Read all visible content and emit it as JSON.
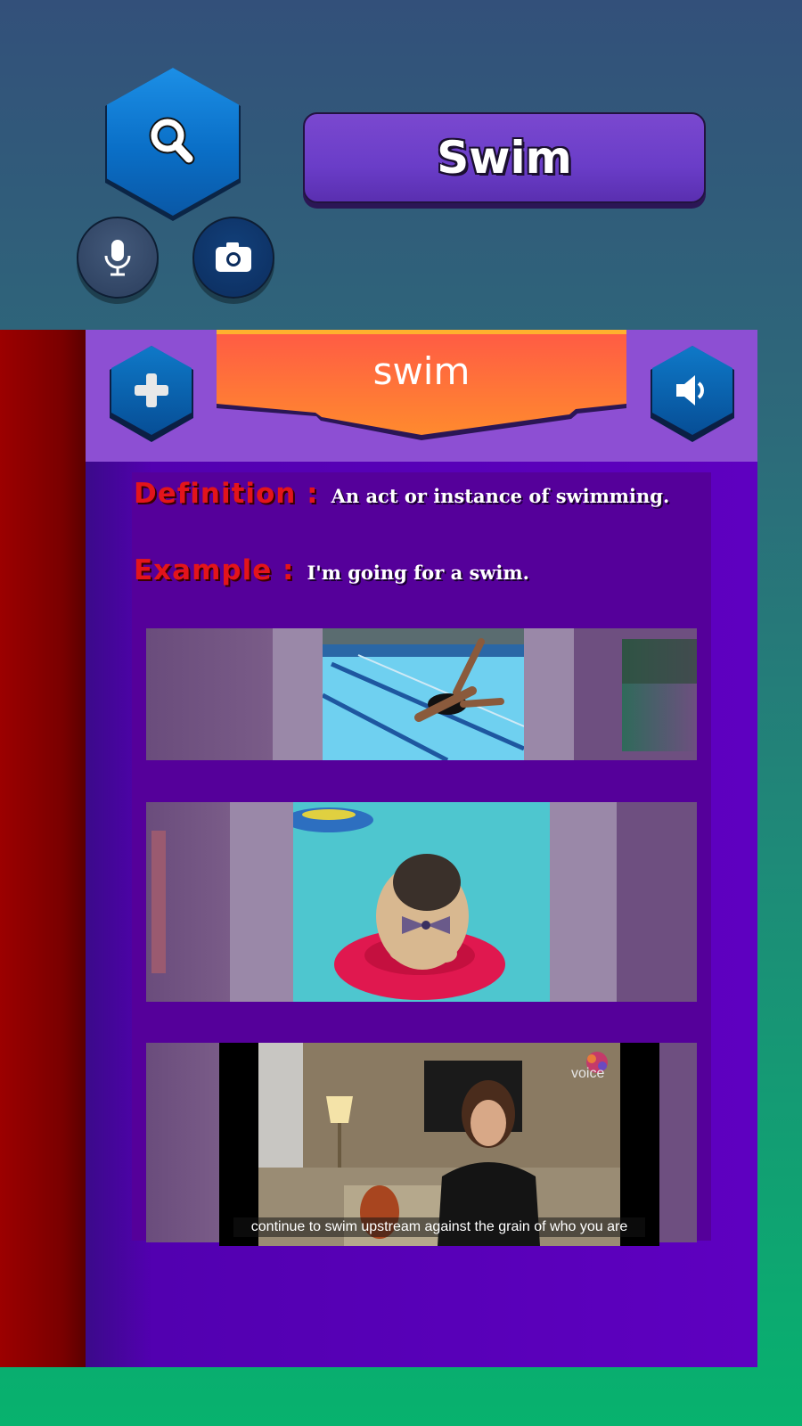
{
  "search": {
    "word": "Swim",
    "icons": {
      "search": "search-icon",
      "mic": "microphone-icon",
      "camera": "camera-icon"
    }
  },
  "card": {
    "banner_word": "swim",
    "icons": {
      "add": "plus-icon",
      "audio": "speaker-icon"
    },
    "definition_label": "Definition :",
    "definition_text": "An act or instance of swimming.",
    "example_label": "Example :",
    "example_text": "I'm going for a swim."
  },
  "media": {
    "video_caption": "continue to swim upstream against the grain of who you are",
    "video_logo": "voice"
  },
  "colors": {
    "accent_purple": "#6a3dc8",
    "banner_orange": "#ff6a3a",
    "label_red": "#e3141b",
    "button_blue": "#0a6fc7"
  }
}
